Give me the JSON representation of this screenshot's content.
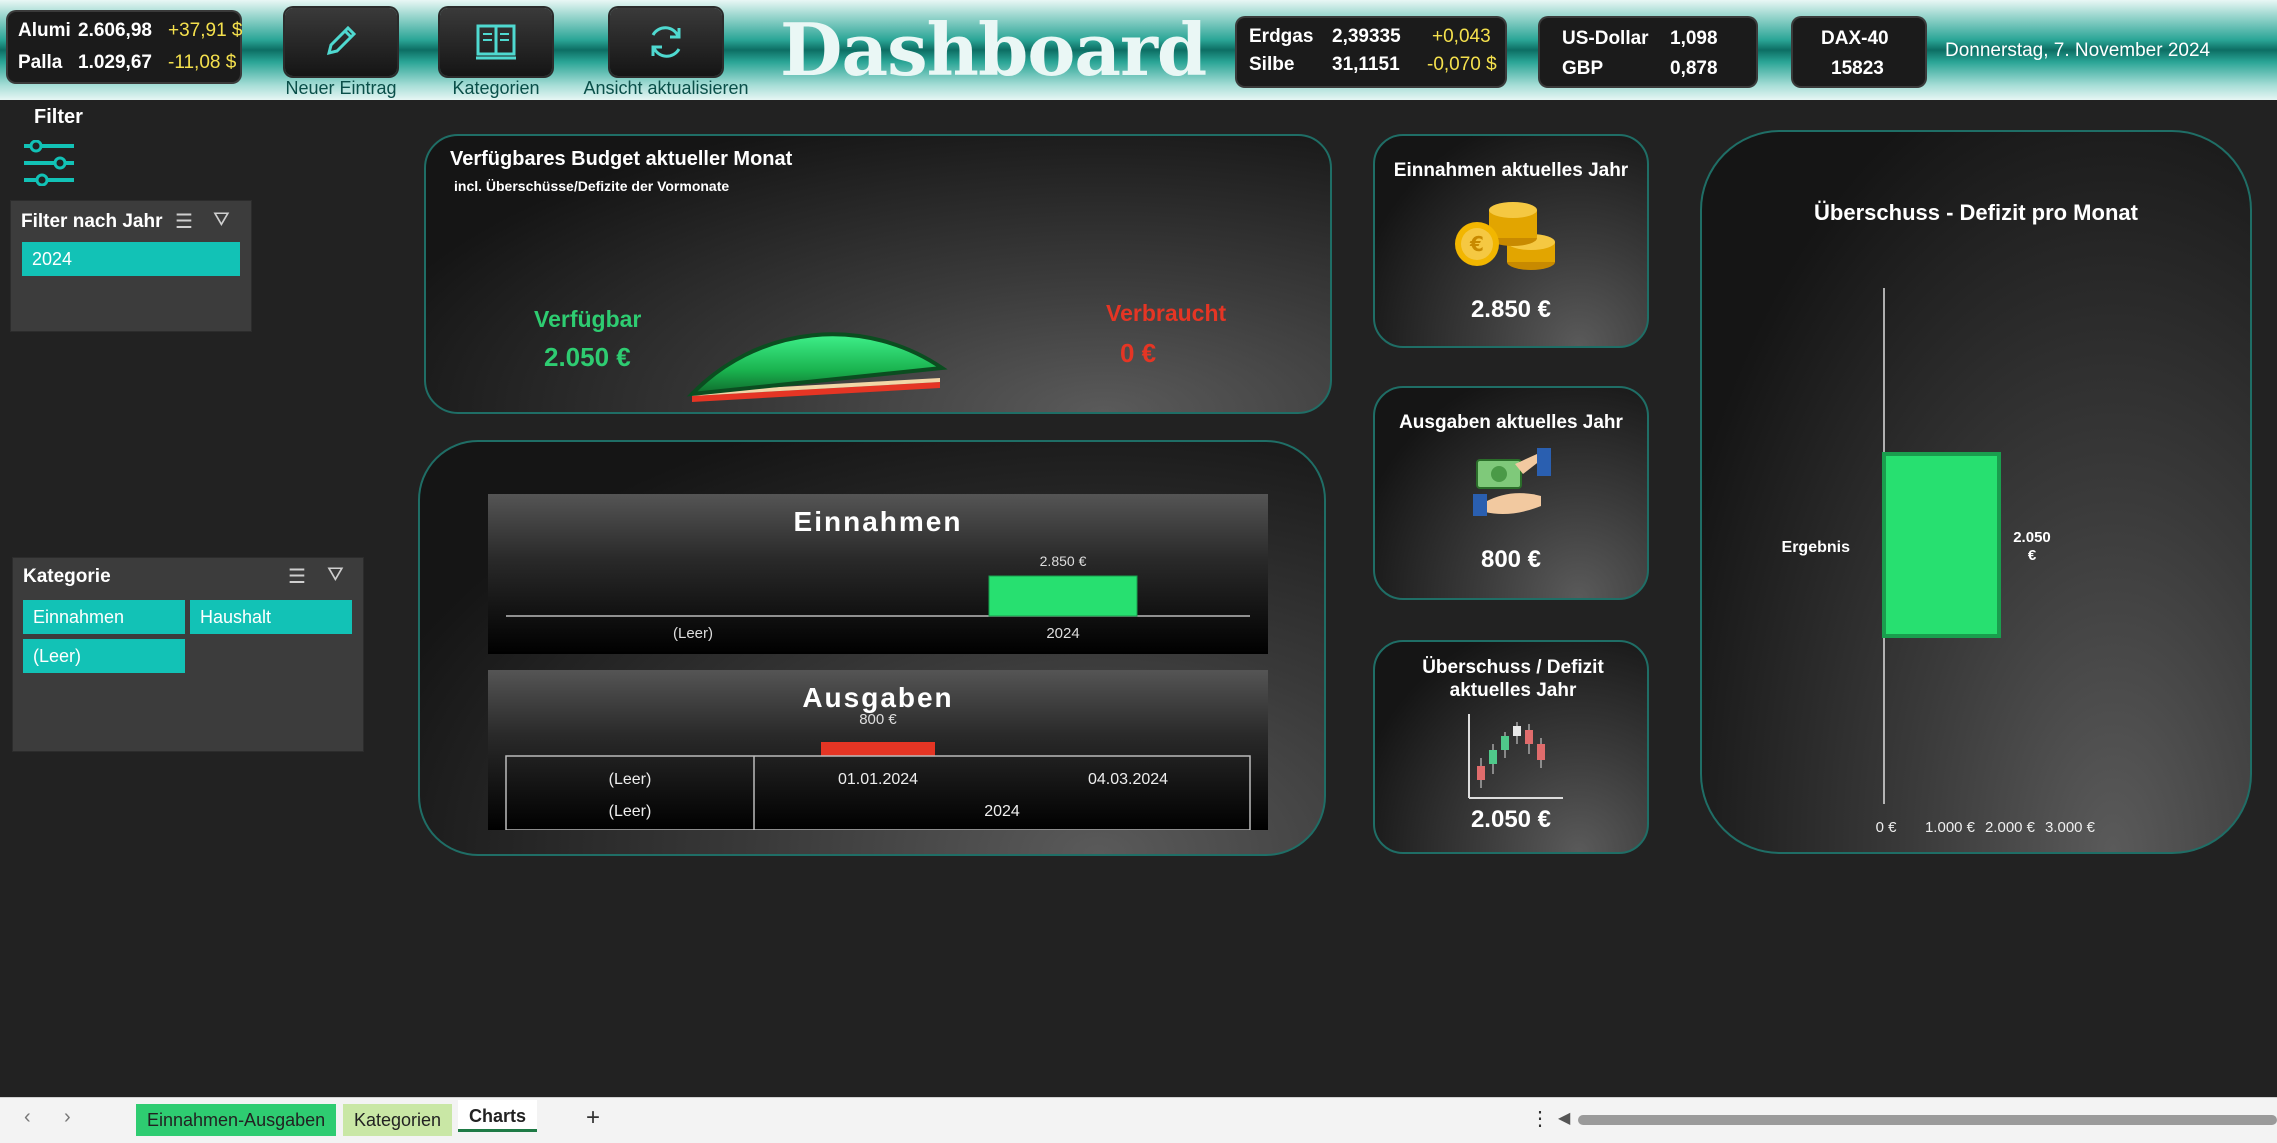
{
  "header": {
    "commodities1": [
      {
        "name": "Alumi",
        "price": "2.606,98",
        "change": "+37,91 $"
      },
      {
        "name": "Palla",
        "price": "1.029,67",
        "change": "-11,08 $"
      }
    ],
    "buttons": [
      {
        "label": "Neuer Eintrag",
        "icon": "pencil-icon"
      },
      {
        "label": "Kategorien",
        "icon": "book-icon"
      },
      {
        "label": "Ansicht aktualisieren",
        "icon": "refresh-icon"
      }
    ],
    "title": "Dashboard",
    "commodities2": [
      {
        "name": "Erdgas",
        "price": "2,39335",
        "change": "+0,043"
      },
      {
        "name": "Silbe",
        "price": "31,1151",
        "change": "-0,070 $"
      }
    ],
    "currencies": [
      {
        "name": "US-Dollar",
        "value": "1,098"
      },
      {
        "name": "GBP",
        "value": "0,878"
      }
    ],
    "index": {
      "name": "DAX-40",
      "value": "15823"
    },
    "date": "Donnerstag, 7. November 2024"
  },
  "sidebar": {
    "filter_title": "Filter",
    "year_slicer": {
      "title": "Filter nach Jahr",
      "items": [
        "2024"
      ]
    },
    "category_slicer": {
      "title": "Kategorie",
      "items": [
        "Einnahmen",
        "Haushalt",
        "(Leer)"
      ]
    }
  },
  "budget": {
    "title": "Verfügbares Budget aktueller Monat",
    "subtitle": "incl. Überschüsse/Defizite der Vormonate",
    "available_label": "Verfügbar",
    "available_value": "2.050 €",
    "used_label": "Verbraucht",
    "used_value": "0 €",
    "available_share": 1.0
  },
  "income_chart": {
    "title": "Einnahmen",
    "data_label": "2.850 €",
    "categories": [
      "(Leer)",
      "2024"
    ]
  },
  "expense_chart": {
    "title": "Ausgaben",
    "data_label": "800 €",
    "row1": [
      "(Leer)",
      "01.01.2024",
      "04.03.2024"
    ],
    "row2": [
      "(Leer)",
      "2024"
    ]
  },
  "kpis": {
    "income": {
      "title": "Einnahmen aktuelles Jahr",
      "value": "2.850 €",
      "icon": "coins-icon"
    },
    "expenses": {
      "title": "Ausgaben aktuelles Jahr",
      "value": "800 €",
      "icon": "money-hand-icon"
    },
    "surplus": {
      "title": "Überschuss / Defizit aktuelles Jahr",
      "value": "2.050 €",
      "icon": "candlestick-icon"
    }
  },
  "surplus_chart_text": {
    "title": "Überschuss - Defizit pro Monat",
    "category": "Ergebnis",
    "data_label_line1": "2.050",
    "data_label_line2": "€",
    "ticks": [
      "0 €",
      "1.000 €",
      "2.000 €",
      "3.000 €"
    ]
  },
  "chart_data": [
    {
      "type": "bar",
      "title": "Einnahmen",
      "categories": [
        "(Leer)",
        "2024"
      ],
      "values": [
        0,
        2850
      ],
      "data_labels": [
        "",
        "2.850 €"
      ]
    },
    {
      "type": "bar",
      "title": "Ausgaben",
      "categories": [
        "2024"
      ],
      "values": [
        800
      ],
      "data_labels": [
        "800 €"
      ]
    },
    {
      "type": "bar",
      "orientation": "horizontal",
      "title": "Überschuss - Defizit pro Monat",
      "categories": [
        "Ergebnis"
      ],
      "values": [
        2050
      ],
      "xlim": [
        0,
        3000
      ],
      "xticks": [
        "0 €",
        "1.000 €",
        "2.000 €",
        "3.000 €"
      ]
    }
  ],
  "tabs": {
    "items": [
      {
        "label": "Einnahmen-Ausgaben",
        "color": "#2ecc71"
      },
      {
        "label": "Kategorien",
        "color": "#c9e7a5"
      },
      {
        "label": "Charts",
        "color": "#ffffff"
      }
    ],
    "add_symbol": "+",
    "menu_symbol": "⋮"
  },
  "colors": {
    "accent": "#12c2b6",
    "green": "#27e070",
    "red": "#e53524",
    "used_red": "#e53524"
  }
}
